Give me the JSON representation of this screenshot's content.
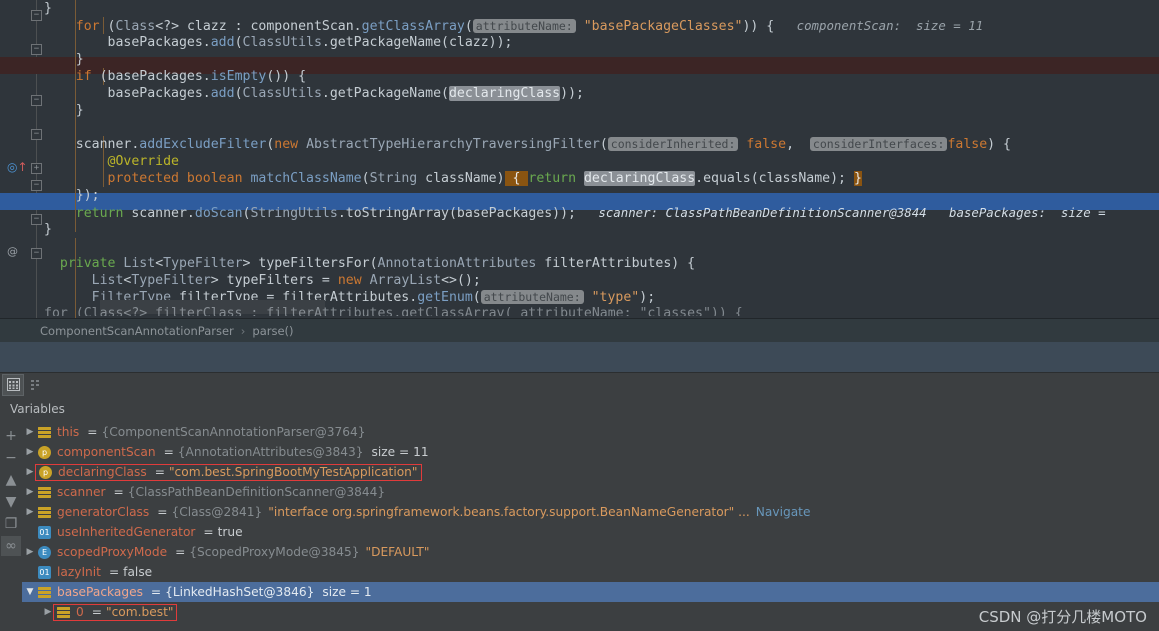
{
  "editor": {
    "lines": [
      {
        "indent": 0,
        "segments": [
          {
            "t": "}",
            "c": "pln"
          }
        ]
      },
      {
        "indent": 0,
        "segments": [
          {
            "t": "    ",
            "c": "pln"
          },
          {
            "t": "for",
            "c": "kw"
          },
          {
            "t": " (",
            "c": "pln"
          },
          {
            "t": "Class",
            "c": "typ"
          },
          {
            "t": "<?> clazz : componentScan.",
            "c": "pln"
          },
          {
            "t": "getClassArray",
            "c": "mtd"
          },
          {
            "t": "(",
            "c": "pln"
          },
          {
            "t": "attributeName:",
            "c": "hint"
          },
          {
            "t": " ",
            "c": "pln"
          },
          {
            "t": "\"basePackageClasses\"",
            "c": "str"
          },
          {
            "t": ")) {",
            "c": "pln"
          },
          {
            "t": "   componentScan:  size = 11",
            "c": "inlay"
          }
        ]
      },
      {
        "indent": 0,
        "segments": [
          {
            "t": "        basePackages.",
            "c": "pln"
          },
          {
            "t": "add",
            "c": "mtd"
          },
          {
            "t": "(",
            "c": "pln"
          },
          {
            "t": "ClassUtils",
            "c": "typ"
          },
          {
            "t": ".getPackageName(clazz));",
            "c": "pln"
          }
        ]
      },
      {
        "indent": 0,
        "segments": [
          {
            "t": "    }",
            "c": "pln"
          }
        ]
      },
      {
        "indent": 0,
        "segments": [
          {
            "t": "    ",
            "c": "pln"
          },
          {
            "t": "if",
            "c": "kw"
          },
          {
            "t": " (basePackages.",
            "c": "pln"
          },
          {
            "t": "isEmpty",
            "c": "mtd"
          },
          {
            "t": "()) {",
            "c": "pln"
          }
        ]
      },
      {
        "indent": 0,
        "segments": [
          {
            "t": "        basePackages.",
            "c": "pln"
          },
          {
            "t": "add",
            "c": "mtd"
          },
          {
            "t": "(",
            "c": "pln"
          },
          {
            "t": "ClassUtils",
            "c": "typ"
          },
          {
            "t": ".getPackageName(",
            "c": "pln"
          },
          {
            "t": "declaringClass",
            "c": "ident-hl"
          },
          {
            "t": "));",
            "c": "pln"
          }
        ]
      },
      {
        "indent": 0,
        "segments": [
          {
            "t": "    }",
            "c": "pln"
          }
        ]
      },
      {
        "indent": 0,
        "segments": []
      },
      {
        "indent": 0,
        "segments": [
          {
            "t": "    scanner.",
            "c": "pln"
          },
          {
            "t": "addExcludeFilter",
            "c": "mtd"
          },
          {
            "t": "(",
            "c": "pln"
          },
          {
            "t": "new",
            "c": "kw"
          },
          {
            "t": " ",
            "c": "pln"
          },
          {
            "t": "AbstractTypeHierarchyTraversingFilter",
            "c": "typ"
          },
          {
            "t": "(",
            "c": "pln"
          },
          {
            "t": "considerInherited:",
            "c": "hint"
          },
          {
            "t": " ",
            "c": "pln"
          },
          {
            "t": "false",
            "c": "kw"
          },
          {
            "t": ",  ",
            "c": "pln"
          },
          {
            "t": "considerInterfaces:",
            "c": "hint"
          },
          {
            "t": "",
            "c": "pln"
          },
          {
            "t": "false",
            "c": "kw"
          },
          {
            "t": ") {",
            "c": "pln"
          }
        ]
      },
      {
        "indent": 0,
        "segments": [
          {
            "t": "        ",
            "c": "pln"
          },
          {
            "t": "@Override",
            "c": "anno"
          }
        ]
      },
      {
        "indent": 0,
        "segments": [
          {
            "t": "        ",
            "c": "pln"
          },
          {
            "t": "protected boolean",
            "c": "kw"
          },
          {
            "t": " ",
            "c": "pln"
          },
          {
            "t": "matchClassName",
            "c": "mtd"
          },
          {
            "t": "(",
            "c": "pln"
          },
          {
            "t": "String",
            "c": "typ"
          },
          {
            "t": " className)",
            "c": "pln"
          },
          {
            "t": " { ",
            "c": "brace-hl"
          },
          {
            "t": "return",
            "c": "kw2"
          },
          {
            "t": " ",
            "c": "pln"
          },
          {
            "t": "declaringClass",
            "c": "ident-hl"
          },
          {
            "t": ".equals(className); ",
            "c": "pln"
          },
          {
            "t": "}",
            "c": "brace-hl"
          }
        ]
      },
      {
        "indent": 0,
        "segments": [
          {
            "t": "    });",
            "c": "pln"
          }
        ]
      },
      {
        "indent": 0,
        "segments": [
          {
            "t": "    ",
            "c": "pln"
          },
          {
            "t": "return",
            "c": "kw2"
          },
          {
            "t": " scanner.",
            "c": "pln"
          },
          {
            "t": "doScan",
            "c": "mtd"
          },
          {
            "t": "(",
            "c": "pln"
          },
          {
            "t": "StringUtils",
            "c": "typ"
          },
          {
            "t": ".toStringArray(basePackages));",
            "c": "pln"
          },
          {
            "t": "   scanner: ClassPathBeanDefinitionScanner@3844   basePackages:  size =",
            "c": "inlay-on-sel"
          }
        ]
      },
      {
        "indent": 0,
        "segments": [
          {
            "t": "}",
            "c": "pln"
          }
        ]
      },
      {
        "indent": 0,
        "segments": []
      },
      {
        "indent": 0,
        "segments": [
          {
            "t": "  ",
            "c": "pln"
          },
          {
            "t": "private",
            "c": "kw2"
          },
          {
            "t": " ",
            "c": "pln"
          },
          {
            "t": "List",
            "c": "typ"
          },
          {
            "t": "<",
            "c": "pln"
          },
          {
            "t": "TypeFilter",
            "c": "typ"
          },
          {
            "t": "> typeFiltersFor(",
            "c": "pln"
          },
          {
            "t": "AnnotationAttributes",
            "c": "typ"
          },
          {
            "t": " filterAttributes) {",
            "c": "pln"
          }
        ]
      },
      {
        "indent": 0,
        "segments": [
          {
            "t": "      ",
            "c": "pln"
          },
          {
            "t": "List",
            "c": "typ"
          },
          {
            "t": "<",
            "c": "pln"
          },
          {
            "t": "TypeFilter",
            "c": "typ"
          },
          {
            "t": "> typeFilters = ",
            "c": "pln"
          },
          {
            "t": "new",
            "c": "kw"
          },
          {
            "t": " ",
            "c": "pln"
          },
          {
            "t": "ArrayList",
            "c": "typ"
          },
          {
            "t": "<>();",
            "c": "pln"
          }
        ]
      },
      {
        "indent": 0,
        "segments": [
          {
            "t": "      ",
            "c": "pln"
          },
          {
            "t": "FilterType",
            "c": "typ"
          },
          {
            "t": " filterType = filterAttributes.",
            "c": "pln"
          },
          {
            "t": "getEnum",
            "c": "mtd"
          },
          {
            "t": "(",
            "c": "pln"
          },
          {
            "t": "attributeName:",
            "c": "hint"
          },
          {
            "t": " ",
            "c": "pln"
          },
          {
            "t": "\"type\"",
            "c": "str"
          },
          {
            "t": ");",
            "c": "pln"
          }
        ]
      }
    ],
    "cutoff_line": "      for (Class<?> filterClass : filterAttributes.getClassArray( attributeName: \"classes\")) {"
  },
  "breadcrumb": {
    "class": "ComponentScanAnnotationParser",
    "separator": "›",
    "method": "parse()"
  },
  "panel": {
    "toolbar": [
      {
        "name": "table-view-icon",
        "glyph": "▦",
        "active": true
      },
      {
        "name": "sort-view-icon",
        "glyph": "⇶",
        "active": false
      }
    ],
    "variables_title": "Variables",
    "rail": [
      {
        "name": "add-watch-button",
        "glyph": "+",
        "boxed": false
      },
      {
        "name": "remove-watch-button",
        "glyph": "−",
        "boxed": false
      },
      {
        "name": "move-up-button",
        "glyph": "▲",
        "boxed": false
      },
      {
        "name": "move-down-button",
        "glyph": "▼",
        "boxed": false
      },
      {
        "name": "copy-value-button",
        "glyph": "❐",
        "boxed": false
      },
      {
        "name": "watches-toggle-button",
        "glyph": "∞",
        "boxed": true
      }
    ]
  },
  "variables": [
    {
      "indent": 0,
      "expandable": true,
      "expanded": false,
      "icon": "obj",
      "name": "this",
      "eq": "=",
      "type": "{ComponentScanAnnotationParser@3764}",
      "value": "",
      "size": "",
      "selected": false,
      "boxed": false,
      "navigate": ""
    },
    {
      "indent": 0,
      "expandable": true,
      "expanded": false,
      "icon": "param",
      "name": "componentScan",
      "eq": "=",
      "type": "{AnnotationAttributes@3843}",
      "value": "",
      "size": "size = 11",
      "selected": false,
      "boxed": false,
      "navigate": ""
    },
    {
      "indent": 0,
      "expandable": true,
      "expanded": false,
      "icon": "param",
      "name": "declaringClass",
      "eq": "=",
      "type": "",
      "value": "\"com.best.SpringBootMyTestApplication\"",
      "size": "",
      "selected": false,
      "boxed": true,
      "navigate": ""
    },
    {
      "indent": 0,
      "expandable": true,
      "expanded": false,
      "icon": "obj",
      "name": "scanner",
      "eq": "=",
      "type": "{ClassPathBeanDefinitionScanner@3844}",
      "value": "",
      "size": "",
      "selected": false,
      "boxed": false,
      "navigate": ""
    },
    {
      "indent": 0,
      "expandable": true,
      "expanded": false,
      "icon": "obj",
      "name": "generatorClass",
      "eq": "=",
      "type": "{Class@2841}",
      "value": "\"interface org.springframework.beans.factory.support.BeanNameGenerator\" ...",
      "size": "",
      "selected": false,
      "boxed": false,
      "navigate": "Navigate"
    },
    {
      "indent": 0,
      "expandable": false,
      "expanded": false,
      "icon": "prim",
      "name": "useInheritedGenerator",
      "eq": "=",
      "type": "",
      "value": "true",
      "value_kind": "bool",
      "size": "",
      "selected": false,
      "boxed": false,
      "navigate": ""
    },
    {
      "indent": 0,
      "expandable": true,
      "expanded": false,
      "icon": "enum",
      "name": "scopedProxyMode",
      "eq": "=",
      "type": "{ScopedProxyMode@3845}",
      "value": "\"DEFAULT\"",
      "size": "",
      "selected": false,
      "boxed": false,
      "navigate": ""
    },
    {
      "indent": 0,
      "expandable": false,
      "expanded": false,
      "icon": "prim",
      "name": "lazyInit",
      "eq": "=",
      "type": "",
      "value": "false",
      "value_kind": "bool",
      "size": "",
      "selected": false,
      "boxed": false,
      "navigate": ""
    },
    {
      "indent": 0,
      "expandable": true,
      "expanded": true,
      "icon": "obj",
      "name": "basePackages",
      "eq": "=",
      "type": "{LinkedHashSet@3846}",
      "value": "",
      "size": "size = 1",
      "selected": true,
      "boxed": false,
      "navigate": ""
    },
    {
      "indent": 1,
      "expandable": true,
      "expanded": false,
      "icon": "obj",
      "name": "0",
      "eq": "=",
      "type": "",
      "value": "\"com.best\"",
      "size": "",
      "selected": false,
      "boxed": true,
      "navigate": ""
    }
  ],
  "watermark": "CSDN @打分几楼MOTO",
  "icons": {
    "breakpoint": "breakpoint-icon",
    "override": "override-method-icon",
    "annotation": "annotation-gutter-icon"
  }
}
